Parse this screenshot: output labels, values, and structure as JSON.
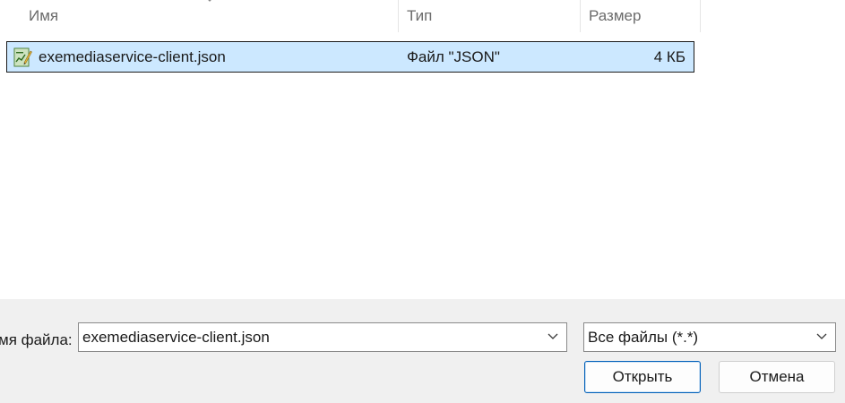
{
  "columns": {
    "name": "Имя",
    "type": "Тип",
    "size": "Размер"
  },
  "files": [
    {
      "name": "exemediaservice-client.json",
      "type": "Файл \"JSON\"",
      "size": "4 КБ",
      "icon": "json-file-icon",
      "selected": true
    }
  ],
  "bottom": {
    "filename_label": "мя файла:",
    "filename_value": "exemediaservice-client.json",
    "filter_value": "Все файлы (*.*)",
    "open_label": "Открыть",
    "cancel_label": "Отмена"
  },
  "colors": {
    "selection_bg": "#cce8ff",
    "panel_bg": "#f0f0f0",
    "primary_border": "#005fb8"
  }
}
